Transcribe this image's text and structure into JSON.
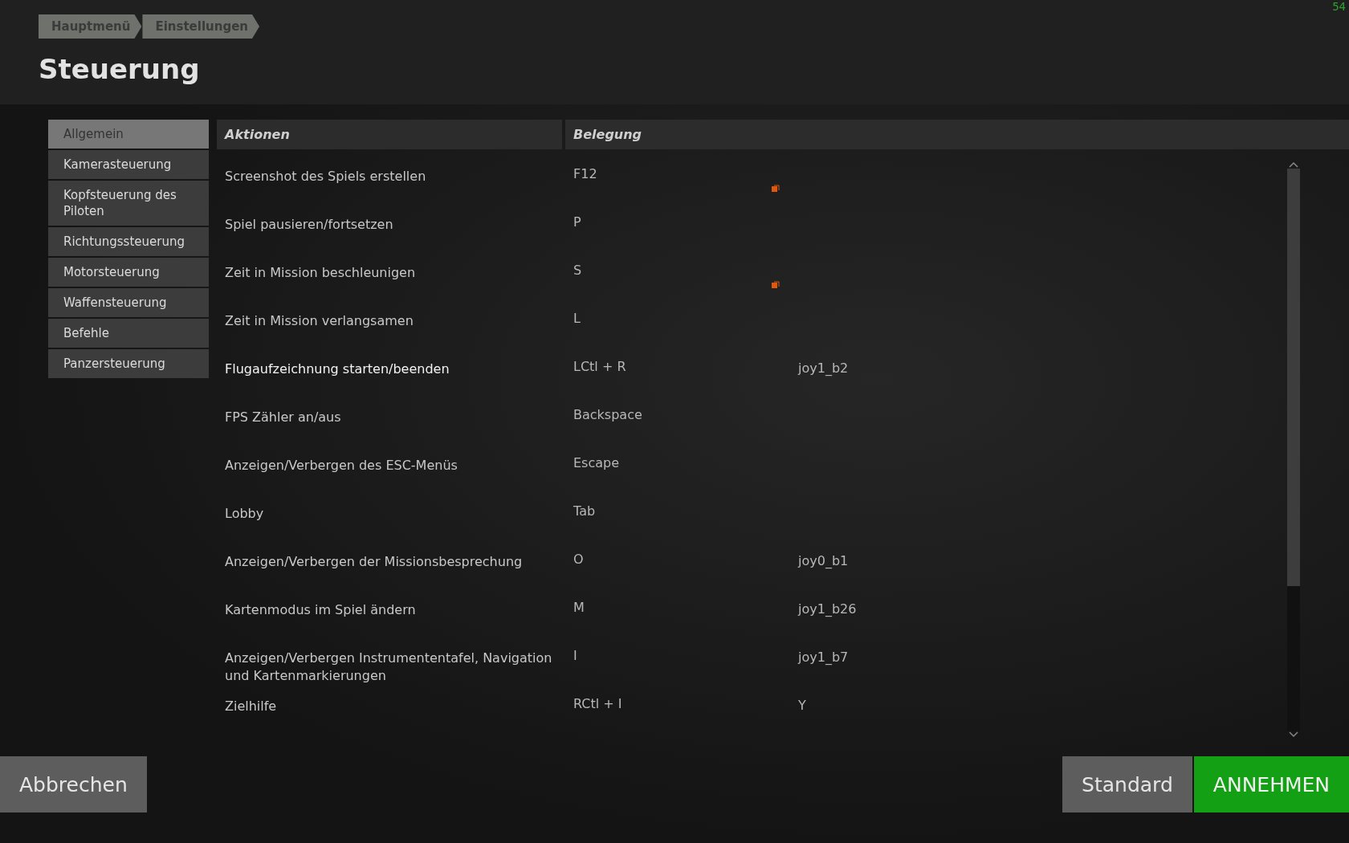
{
  "fps_counter": "54",
  "breadcrumb": [
    "Hauptmenü",
    "Einstellungen"
  ],
  "title": "Steuerung",
  "sidebar": {
    "items": [
      {
        "label": "Allgemein",
        "selected": true
      },
      {
        "label": "Kamerasteuerung",
        "selected": false
      },
      {
        "label": "Kopfsteuerung des Piloten",
        "selected": false
      },
      {
        "label": "Richtungssteuerung",
        "selected": false
      },
      {
        "label": "Motorsteuerung",
        "selected": false
      },
      {
        "label": "Waffensteuerung",
        "selected": false
      },
      {
        "label": "Befehle",
        "selected": false
      },
      {
        "label": "Panzersteuerung",
        "selected": false
      }
    ]
  },
  "table": {
    "columns": [
      "Aktionen",
      "Belegung"
    ],
    "rows": [
      {
        "action": "Screenshot des Spiels erstellen",
        "key": "F12",
        "alt_key": "",
        "flagged": true,
        "hovered": false
      },
      {
        "action": "Spiel pausieren/fortsetzen",
        "key": "P",
        "alt_key": "",
        "flagged": false,
        "hovered": false
      },
      {
        "action": "Zeit in Mission beschleunigen",
        "key": "S",
        "alt_key": "",
        "flagged": true,
        "hovered": false
      },
      {
        "action": "Zeit in Mission verlangsamen",
        "key": "L",
        "alt_key": "",
        "flagged": false,
        "hovered": false
      },
      {
        "action": "Flugaufzeichnung starten/beenden",
        "key": "LCtl + R",
        "alt_key": "joy1_b2",
        "flagged": false,
        "hovered": true
      },
      {
        "action": "FPS Zähler an/aus",
        "key": "Backspace",
        "alt_key": "",
        "flagged": false,
        "hovered": false
      },
      {
        "action": "Anzeigen/Verbergen des ESC-Menüs",
        "key": "Escape",
        "alt_key": "",
        "flagged": false,
        "hovered": false
      },
      {
        "action": "Lobby",
        "key": "Tab",
        "alt_key": "",
        "flagged": false,
        "hovered": false
      },
      {
        "action": "Anzeigen/Verbergen der Missionsbesprechung",
        "key": "O",
        "alt_key": "joy0_b1",
        "flagged": false,
        "hovered": false
      },
      {
        "action": "Kartenmodus im Spiel ändern",
        "key": "M",
        "alt_key": "joy1_b26",
        "flagged": false,
        "hovered": false
      },
      {
        "action": "Anzeigen/Verbergen Instrumententafel, Navigation und Kartenmarkierungen",
        "key": "I",
        "alt_key": "joy1_b7",
        "flagged": false,
        "hovered": false
      },
      {
        "action": "Zielhilfe",
        "key": "RCtl + I",
        "alt_key": "Y",
        "flagged": false,
        "hovered": false
      }
    ]
  },
  "buttons": {
    "cancel": "Abbrechen",
    "default": "Standard",
    "accept": "ANNEHMEN"
  }
}
